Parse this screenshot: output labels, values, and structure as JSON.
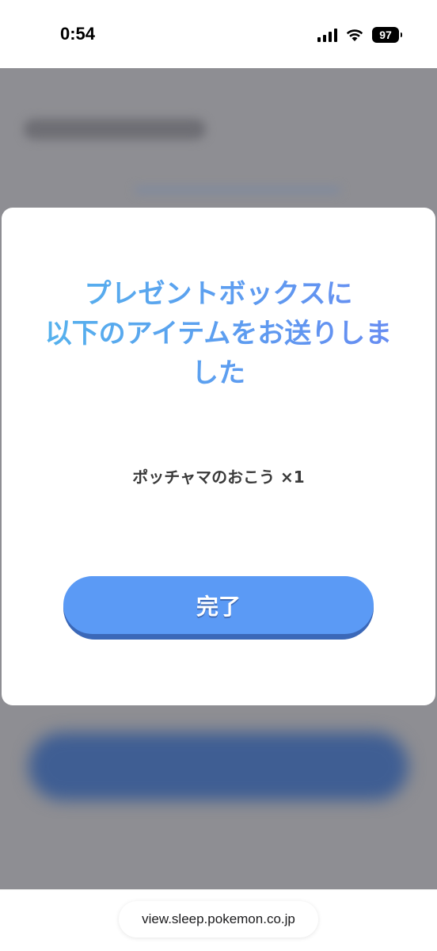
{
  "status_bar": {
    "time": "0:54",
    "battery": "97",
    "icons": [
      "signal-icon",
      "wifi-icon",
      "battery-icon"
    ]
  },
  "modal": {
    "title_lines": [
      "プレゼントボックスに",
      "以下のアイテムをお送りしま",
      "した"
    ],
    "item": "ポッチャマのおこう ×1",
    "done_button": "完了"
  },
  "url_bar": {
    "url": "view.sleep.pokemon.co.jp"
  },
  "colors": {
    "title_gradient_start": "#53b6ec",
    "title_gradient_end": "#6a88f2",
    "button": "#5b9af5",
    "button_shadow": "#3b68b8",
    "overlay": "#8e8e93"
  }
}
